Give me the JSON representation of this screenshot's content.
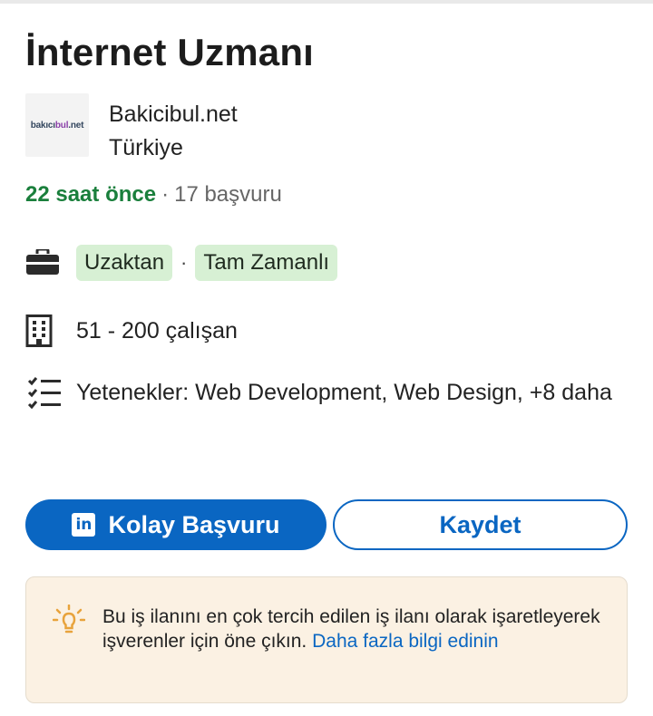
{
  "job": {
    "title": "İnternet Uzmanı",
    "company": "Bakicibul.net",
    "location": "Türkiye",
    "logo": {
      "part1": "bakıcı",
      "part2": "bul",
      "part3": ".net"
    },
    "posted": "22 saat önce",
    "meta_sep": "·",
    "applicants": "17 başvuru"
  },
  "details": {
    "workplace": "Uzaktan",
    "pill_sep": "·",
    "employment": "Tam Zamanlı",
    "company_size": "51 - 200 çalışan",
    "skills": "Yetenekler: Web Development, Web Design, +8 daha"
  },
  "actions": {
    "apply_label": "Kolay Başvuru",
    "linkedin_badge": "in",
    "save_label": "Kaydet"
  },
  "tip": {
    "text": "Bu iş ilanını en çok tercih edilen iş ilanı olarak işaretleyerek işverenler için öne çıkın. ",
    "link": "Daha fazla bilgi edinin"
  },
  "colors": {
    "accent": "#0a66c2",
    "posted_green": "#1a7f3c",
    "pill_bg": "#d7f0d4",
    "tip_bg": "#fbf1e3",
    "tip_icon": "#e8a33c"
  },
  "icons": [
    "briefcase-icon",
    "building-icon",
    "checklist-icon",
    "lightbulb-icon",
    "linkedin-icon"
  ]
}
